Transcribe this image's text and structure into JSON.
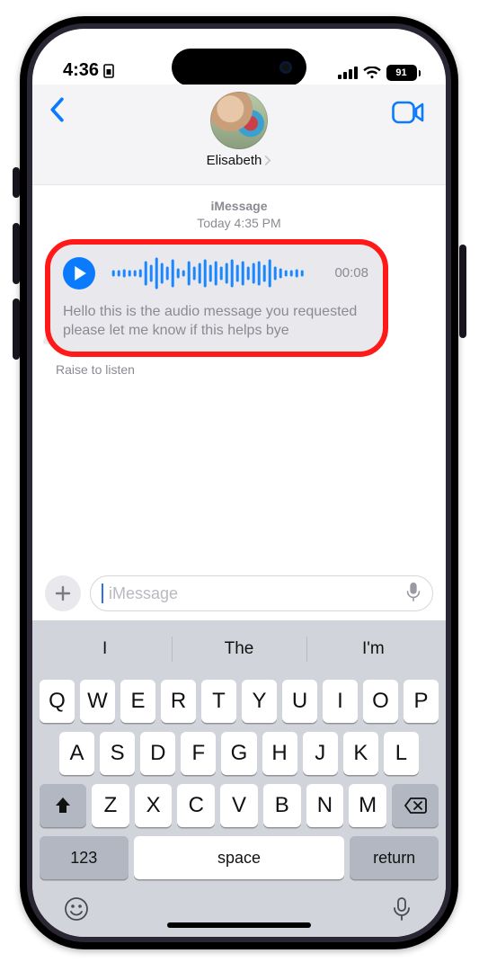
{
  "status": {
    "time": "4:36",
    "battery": "91"
  },
  "header": {
    "contact_name": "Elisabeth"
  },
  "thread": {
    "service": "iMessage",
    "timestamp": "Today 4:35 PM",
    "audio_duration": "00:08",
    "transcript": "Hello this is the audio message you requested please let me know if this helps bye",
    "raise_hint": "Raise to listen"
  },
  "compose": {
    "placeholder": "iMessage"
  },
  "keyboard": {
    "suggestions": [
      "I",
      "The",
      "I'm"
    ],
    "row1": [
      "Q",
      "W",
      "E",
      "R",
      "T",
      "Y",
      "U",
      "I",
      "O",
      "P"
    ],
    "row2": [
      "A",
      "S",
      "D",
      "F",
      "G",
      "H",
      "J",
      "K",
      "L"
    ],
    "row3": [
      "Z",
      "X",
      "C",
      "V",
      "B",
      "N",
      "M"
    ],
    "numbers_label": "123",
    "space_label": "space",
    "return_label": "return"
  }
}
